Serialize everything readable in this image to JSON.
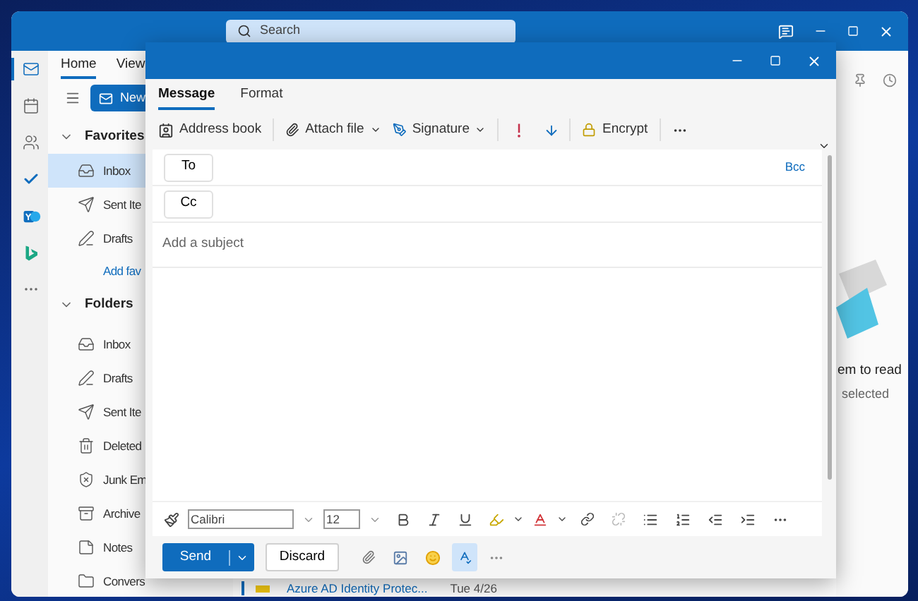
{
  "main_window": {
    "search": {
      "placeholder": "Search"
    },
    "app_rail": [
      {
        "selected": true
      },
      {
        "selected": false
      },
      {
        "selected": false
      },
      {
        "selected": false
      },
      {
        "selected": false
      },
      {
        "selected": false
      },
      {
        "selected": false
      }
    ],
    "ribbon_tabs": [
      {
        "label": "Home",
        "selected": true
      },
      {
        "label": "View",
        "selected": false
      }
    ],
    "new_button": {
      "label": "New"
    },
    "favorites": {
      "label": "Favorites",
      "expanded": true,
      "items": [
        {
          "label": "Inbox",
          "selected": true
        },
        {
          "label": "Sent Ite",
          "selected": false
        },
        {
          "label": "Drafts",
          "selected": false
        }
      ],
      "add_link": "Add fav"
    },
    "folders": {
      "label": "Folders",
      "expanded": true,
      "items": [
        {
          "label": "Inbox",
          "selected": false
        },
        {
          "label": "Drafts",
          "selected": false
        },
        {
          "label": "Sent Ite",
          "selected": false
        },
        {
          "label": "Deleted",
          "selected": false
        },
        {
          "label": "Junk Em",
          "selected": false
        },
        {
          "label": "Archive",
          "selected": false
        },
        {
          "label": "Notes",
          "selected": false
        },
        {
          "label": "Convers",
          "selected": false
        }
      ]
    },
    "message_row": {
      "sender": "Azure AD Identity Protec...",
      "date": "Tue 4/26"
    },
    "reading_pane": {
      "title": "em to read",
      "subtitle": "selected"
    }
  },
  "compose": {
    "tabs": [
      {
        "label": "Message",
        "selected": true
      },
      {
        "label": "Format",
        "selected": false
      }
    ],
    "toolbar": {
      "address_book": "Address book",
      "attach_file": "Attach file",
      "signature": "Signature",
      "encrypt": "Encrypt"
    },
    "to": "To",
    "cc": "Cc",
    "bcc": "Bcc",
    "subject": {
      "placeholder": "Add a subject"
    },
    "format_bar": {
      "font": "Calibri",
      "size": "12"
    },
    "send": "Send",
    "discard": "Discard",
    "editor_selected": true
  }
}
